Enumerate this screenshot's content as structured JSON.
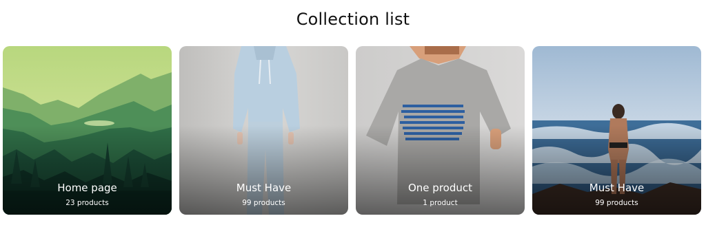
{
  "section": {
    "title": "Collection list"
  },
  "collections": [
    {
      "title": "Home page",
      "count": "23 products",
      "image": "forest-mountain-illustration"
    },
    {
      "title": "Must Have",
      "count": "99 products",
      "image": "person-in-light-blue-hoodie"
    },
    {
      "title": "One product",
      "count": "1 product",
      "image": "person-in-grey-tshirt"
    },
    {
      "title": "Must Have",
      "count": "99 products",
      "image": "person-at-ocean-waves"
    }
  ]
}
